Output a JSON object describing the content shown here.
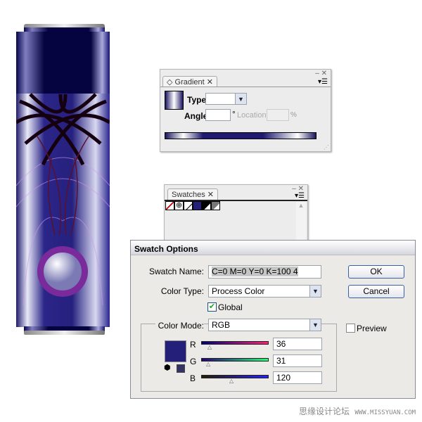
{
  "gradient_panel": {
    "tab_label": "Gradient",
    "type_label": "Type:",
    "type_value": "",
    "angle_label": "Angle:",
    "angle_value": "",
    "degree_symbol": "°",
    "location_label": "Location:",
    "location_value": "",
    "percent_symbol": "%"
  },
  "swatches_panel": {
    "tab_label": "Swatches",
    "swatch_icons": [
      "none-swatch",
      "registration-swatch",
      "white-swatch",
      "blue-global-swatch",
      "black-swatch",
      "gray-swatch"
    ]
  },
  "dialog": {
    "title": "Swatch Options",
    "swatch_name_label": "Swatch Name:",
    "swatch_name_value": "C=0 M=0 Y=0 K=100 4",
    "color_type_label": "Color Type:",
    "color_type_value": "Process Color",
    "global_label": "Global",
    "global_checked": true,
    "color_mode_label": "Color Mode:",
    "color_mode_value": "RGB",
    "preview_label": "Preview",
    "preview_checked": false,
    "ok_label": "OK",
    "cancel_label": "Cancel",
    "channels": [
      {
        "label": "R",
        "value": "36"
      },
      {
        "label": "G",
        "value": "31"
      },
      {
        "label": "B",
        "value": "120"
      }
    ],
    "swatch_color": "#241f78"
  },
  "watermark": {
    "text": "思缘设计论坛",
    "url": "WWW.MISSYUAN.COM"
  }
}
